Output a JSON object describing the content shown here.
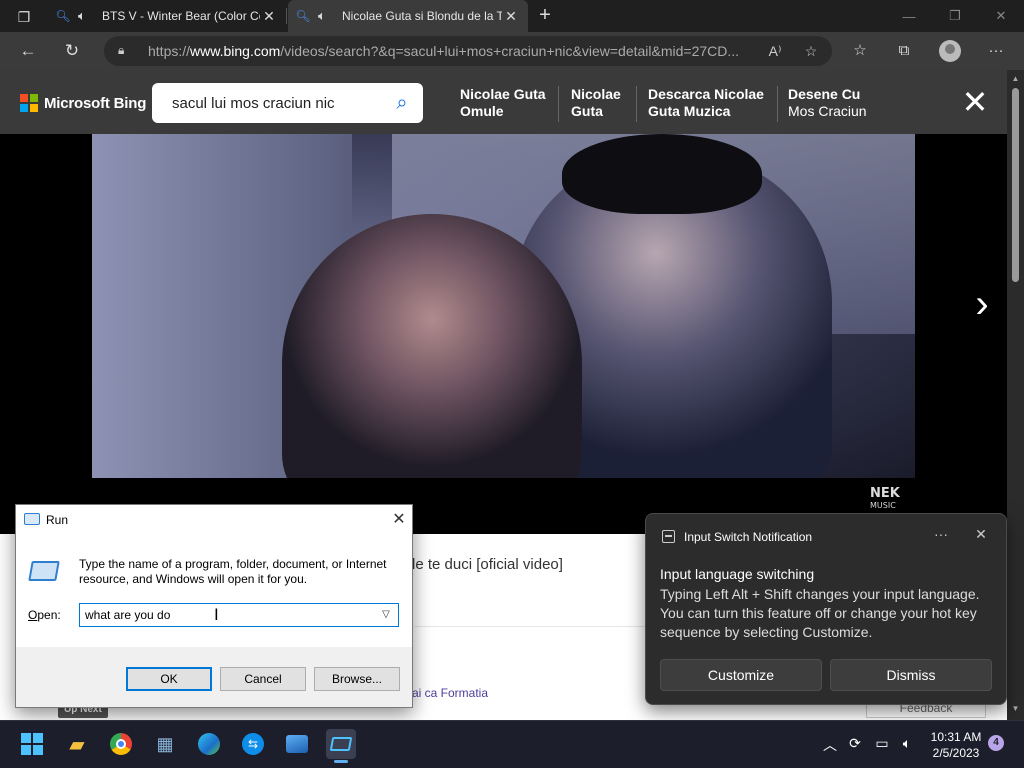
{
  "browser": {
    "tabs": [
      {
        "title": "BTS V - Winter Bear (Color Coded Lyrics"
      },
      {
        "title": "Nicolae Guta si Blondu de la Timisoara"
      }
    ],
    "new_tab_label": "+",
    "url_prefix": "https://",
    "url_domain": "www.bing.com",
    "url_path": "/videos/search?&q=sacul+lui+mos+craciun+nic&view=detail&mid=27CD..."
  },
  "bing": {
    "logo_text": "Microsoft Bing",
    "logo_colors": [
      "#f25022",
      "#7fba00",
      "#00a4ef",
      "#ffb900"
    ],
    "search_query": "sacul lui mos craciun nic",
    "related": [
      {
        "line1": "Nicolae Guta",
        "line2": "Omule"
      },
      {
        "line1": "Nicolae",
        "line2": "Guta"
      },
      {
        "line1": "Descarca Nicolae",
        "line2": "Guta Muzica"
      },
      {
        "line1": "Desene Cu",
        "line2": "Mos Craciun"
      }
    ]
  },
  "video": {
    "watermark_main": "NEK",
    "watermark_sub": "MUSIC",
    "title_fragment": "le te duci [oficial video]",
    "up_next": "Up Next",
    "related_fragment": "ai ca Formatia",
    "feedback": "Feedback"
  },
  "run_dialog": {
    "title": "Run",
    "description": "Type the name of a program, folder, document, or Internet resource, and Windows will open it for you.",
    "open_label_prefix": "O",
    "open_label_rest": "pen:",
    "input_value": "what are you do",
    "ok": "OK",
    "cancel": "Cancel",
    "browse": "Browse..."
  },
  "notification": {
    "app_name": "Input Switch Notification",
    "more": "···",
    "title": "Input language switching",
    "body": "Typing Left Alt + Shift changes your input language. You can turn this feature off or change your hot key sequence by selecting Customize.",
    "customize": "Customize",
    "dismiss": "Dismiss"
  },
  "taskbar": {
    "time": "10:31 AM",
    "date": "2/5/2023",
    "notification_count": "4",
    "accent": "#4cc2ff"
  }
}
